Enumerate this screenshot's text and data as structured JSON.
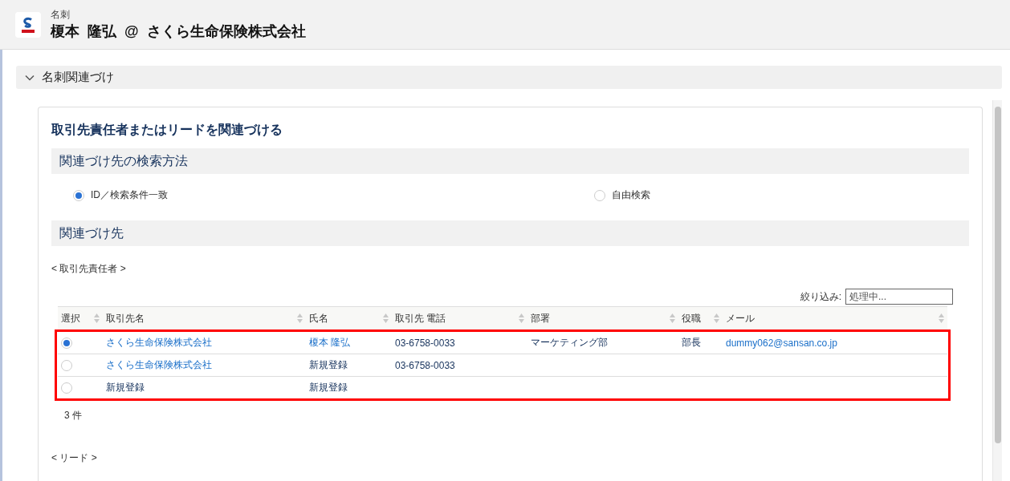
{
  "header": {
    "object_type": "名刺",
    "title": "榎本  隆弘  @  さくら生命保険株式会社"
  },
  "section": {
    "title": "名刺関連づけ",
    "expanded": true
  },
  "card": {
    "title": "取引先責任者またはリードを関連づける",
    "search_method": {
      "heading": "関連づけ先の検索方法",
      "options": [
        {
          "label": "ID／検索条件一致",
          "selected": true
        },
        {
          "label": "自由検索",
          "selected": false
        }
      ]
    },
    "target": {
      "heading": "関連づけ先",
      "contacts": {
        "label": "< 取引先責任者 >",
        "filter": {
          "label": "絞り込み:",
          "value": "処理中..."
        },
        "columns": [
          "選択",
          "取引先名",
          "氏名",
          "取引先 電話",
          "部署",
          "役職",
          "メール"
        ],
        "rows": [
          {
            "selected": true,
            "cells": [
              "",
              {
                "text": "さくら生命保険株式会社",
                "link": true
              },
              {
                "text": "榎本 隆弘",
                "link": true
              },
              {
                "text": "03-6758-0033",
                "link": false
              },
              {
                "text": "マーケティング部",
                "link": false
              },
              {
                "text": "部長",
                "link": false
              },
              {
                "text": "dummy062@sansan.co.jp",
                "link": true
              }
            ]
          },
          {
            "selected": false,
            "cells": [
              "",
              {
                "text": "さくら生命保険株式会社",
                "link": true
              },
              {
                "text": "新規登録",
                "link": false
              },
              {
                "text": "03-6758-0033",
                "link": false
              },
              "",
              "",
              ""
            ]
          },
          {
            "selected": false,
            "cells": [
              "",
              {
                "text": "新規登録",
                "link": false
              },
              {
                "text": "新規登録",
                "link": false
              },
              "",
              "",
              "",
              ""
            ]
          }
        ],
        "count": "3 件"
      },
      "leads_label": "< リード >"
    }
  }
}
